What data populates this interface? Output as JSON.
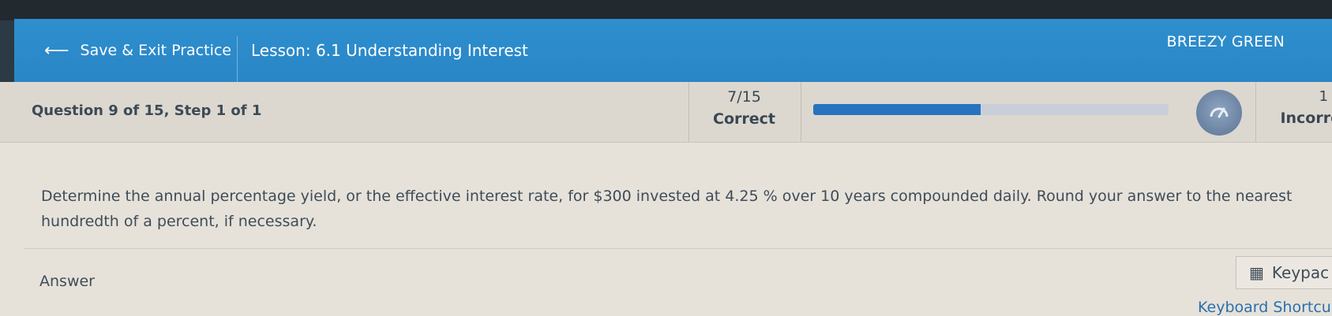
{
  "header": {
    "back_label": "Save & Exit Practice",
    "lesson_label": "Lesson: 6.1 Understanding Interest",
    "user_name": "BREEZY GREEN"
  },
  "status": {
    "question_label": "Question 9 of 15, Step 1 of 1",
    "score_fraction": "7/15",
    "score_label": "Correct",
    "progress_fraction": 0.47,
    "incorrect_count": "1",
    "incorrect_label": "Incorre"
  },
  "question": {
    "text": "Determine the annual percentage yield, or the effective interest rate, for $300 invested at 4.25 %  over 10 years compounded daily. Round your answer to the nearest hundredth of a percent, if necessary."
  },
  "answer": {
    "label": "Answer",
    "keypad_label": "Keypac",
    "shortcuts_label": "Keyboard Shortcu"
  },
  "colors": {
    "header": "#2e8fce",
    "progress_fill": "#2773bd",
    "progress_track": "#c9cfd9",
    "link": "#2b6fae"
  },
  "icons": {
    "back": "arrow-left-icon",
    "gauge": "gauge-icon",
    "keypad": "calculator-icon"
  }
}
